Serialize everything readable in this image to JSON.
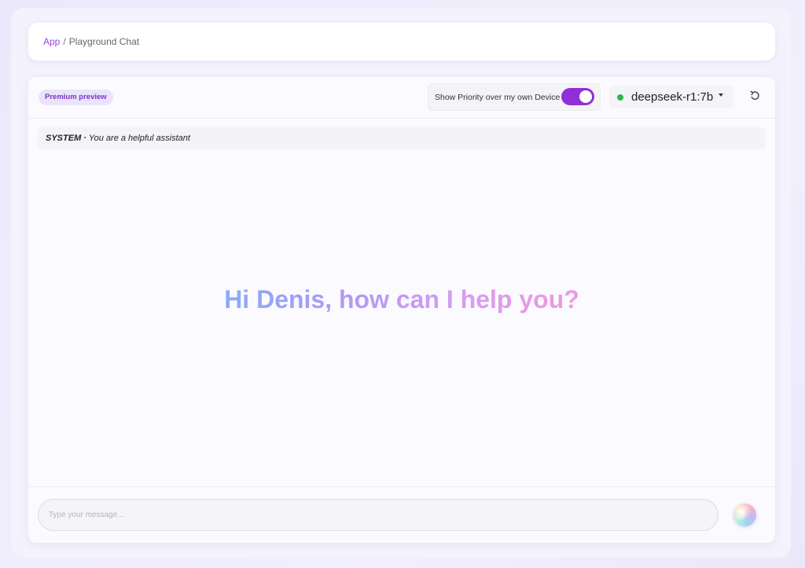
{
  "breadcrumb": {
    "root": "App",
    "separator": "/",
    "current": "Playground Chat"
  },
  "header": {
    "premium_badge": "Premium preview",
    "priority_toggle": {
      "label": "Show Priority over my own Device",
      "enabled": true
    },
    "model": {
      "name": "deepseek-r1:7b",
      "status_color": "#2fb64a"
    },
    "reset_icon": "reset-icon"
  },
  "system_prompt": {
    "label": "SYSTEM",
    "separator": "·",
    "text": "You are a helpful assistant"
  },
  "greeting": "Hi Denis, how can I help you?",
  "composer": {
    "placeholder": "Type your message...",
    "value": "",
    "send_icon": "orb-send-icon"
  },
  "colors": {
    "accent": "#8f2fd6",
    "breadcrumb_link": "#9b46d8",
    "greeting_gradient": [
      "#8aaaf8",
      "#b09af4",
      "#d59cf0",
      "#ee9ae0"
    ]
  }
}
